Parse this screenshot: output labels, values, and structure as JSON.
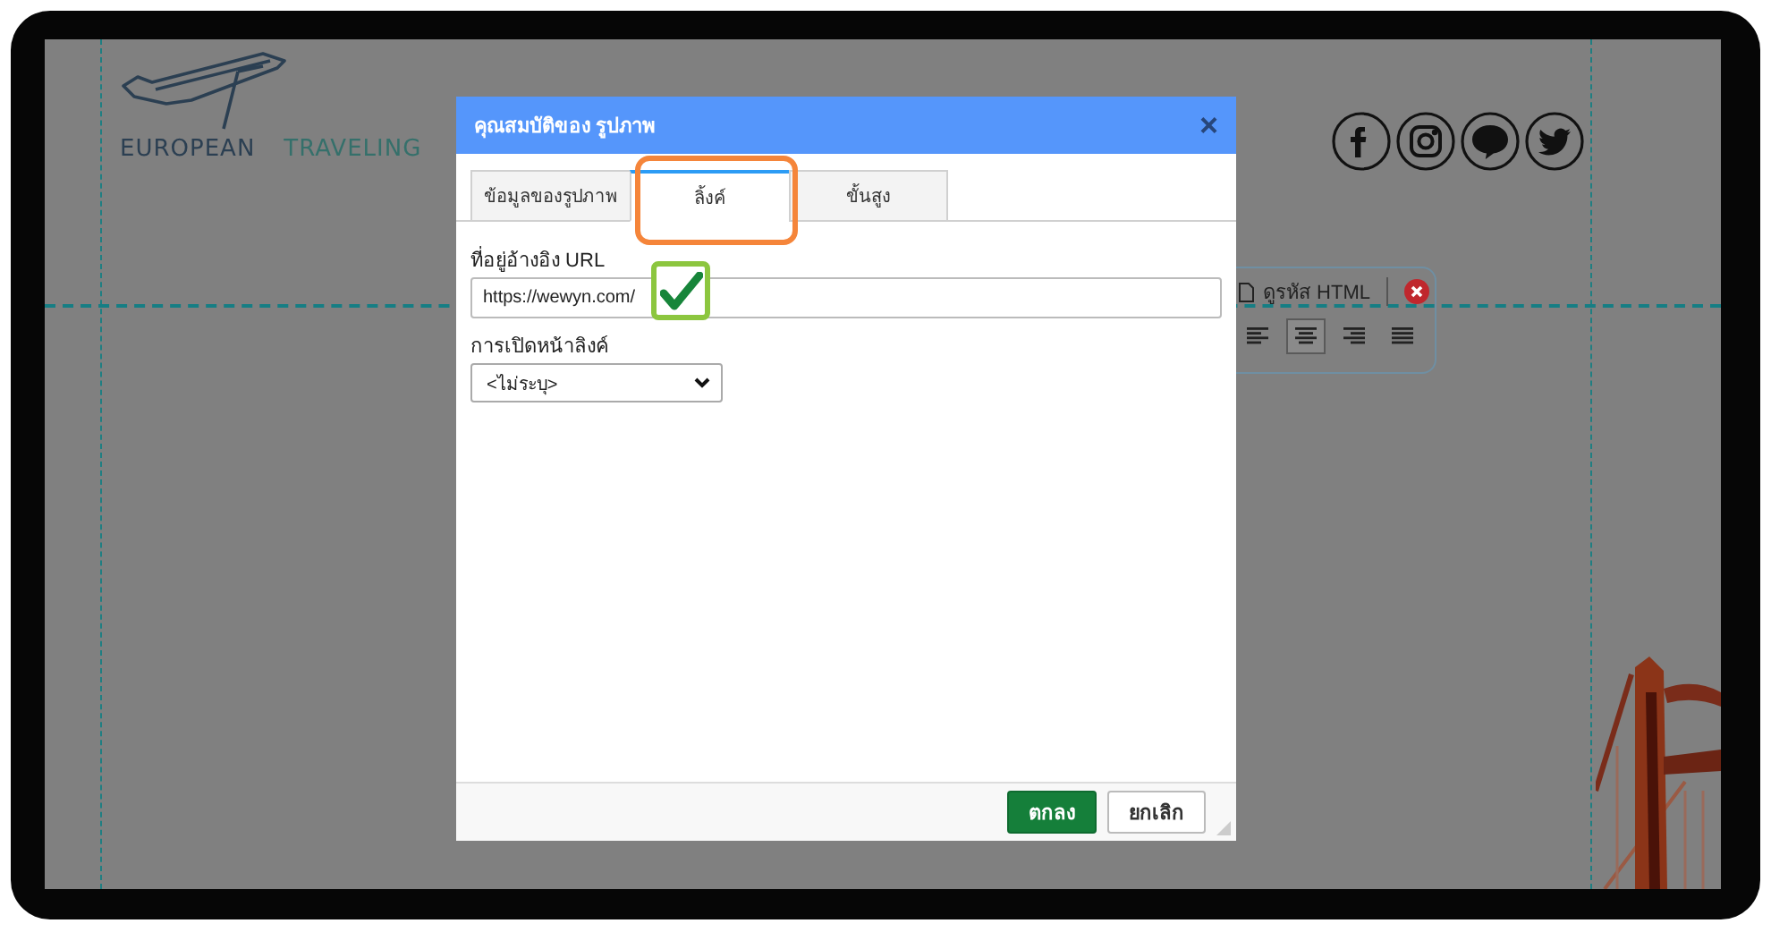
{
  "brand": {
    "word_1": "EUROPEAN",
    "word_2": "TRAVELING"
  },
  "editor_toolbar": {
    "source_label": "ดูรหัส HTML",
    "align_buttons": [
      {
        "kind": "left",
        "selected": false
      },
      {
        "kind": "center",
        "selected": true
      },
      {
        "kind": "right",
        "selected": false
      },
      {
        "kind": "justify",
        "selected": false
      }
    ]
  },
  "dialog": {
    "title": "คุณสมบัติของ รูปภาพ",
    "close": "×",
    "tabs": [
      {
        "label": "ข้อมูลของรูปภาพ",
        "selected": false
      },
      {
        "label": "ลิ้งค์",
        "selected": true
      },
      {
        "label": "ขั้นสูง",
        "selected": false
      }
    ],
    "url_label": "ที่อยู่อ้างอิง URL",
    "url_value": "https://wewyn.com/",
    "target_label": "การเปิดหน้าลิงค์",
    "target_value": "<ไม่ระบุ>",
    "buttons": [
      {
        "label": "ตกลง",
        "kind": "primary"
      },
      {
        "label": "ยกเลิก",
        "kind": "secondary"
      }
    ]
  }
}
